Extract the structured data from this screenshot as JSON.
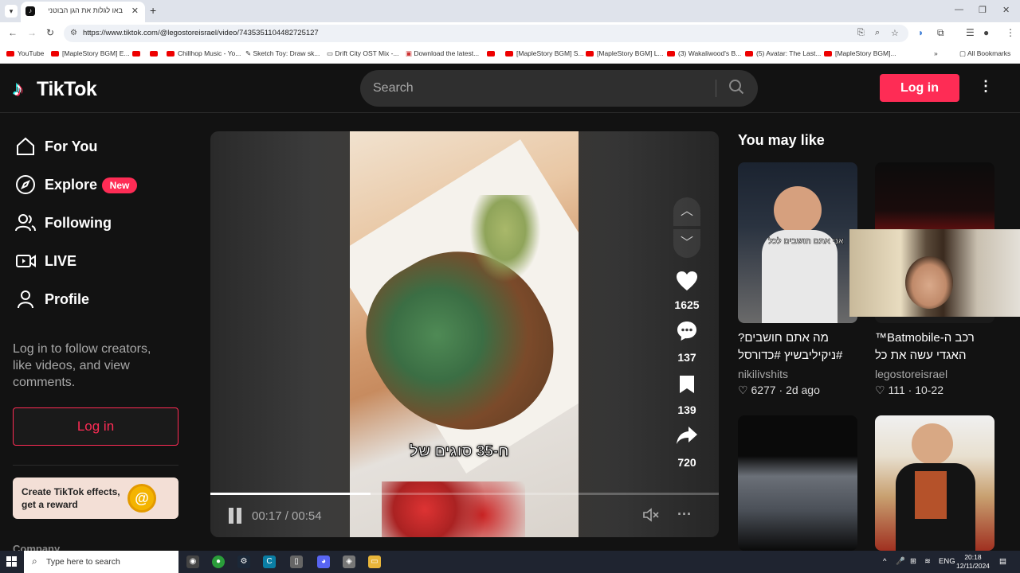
{
  "browser": {
    "tab_title": "באו לגלות את הגן הבוטני",
    "url": "https://www.tiktok.com/@legostoreisrael/video/7435351104482725127",
    "bookmarks": [
      "YouTube",
      "[MapleStory BGM] E...",
      "",
      "",
      "Chillhop Music - Yo...",
      "Sketch Toy: Draw sk...",
      "Drift City OST Mix -...",
      "Download the latest...",
      "",
      "[MapleStory BGM] S...",
      "[MapleStory BGM] L...",
      "(3) Wakaliwood's B...",
      "(5) Avatar: The Last...",
      "[MapleStory BGM]..."
    ],
    "all_bookmarks": "All Bookmarks"
  },
  "header": {
    "logo_text": "TikTok",
    "search_placeholder": "Search",
    "login_label": "Log in"
  },
  "sidebar": {
    "items": [
      {
        "label": "For You",
        "icon": "home-icon"
      },
      {
        "label": "Explore",
        "icon": "compass-icon"
      },
      {
        "label": "Following",
        "icon": "users-icon"
      },
      {
        "label": "LIVE",
        "icon": "live-icon"
      },
      {
        "label": "Profile",
        "icon": "profile-icon"
      }
    ],
    "new_badge": "New",
    "login_note": "Log in to follow creators, like videos, and view comments.",
    "login_button": "Log in",
    "effects_promo": "Create TikTok effects, get a reward",
    "company": "Company"
  },
  "video": {
    "caption": "ח-35 סוגים של",
    "likes": "1625",
    "comments": "137",
    "bookmarks": "139",
    "shares": "720",
    "time": "00:17 / 00:54",
    "progress": 0.315
  },
  "recommendations": {
    "title": "You may like",
    "items": [
      {
        "caption": "מה אתם חושבים? #ניקיליבשיץ #כדורסל",
        "author": "nikilivshits",
        "likes": "6277",
        "date": "2d ago"
      },
      {
        "caption": "רכב ה-Batmobile™ האגדי עשה את כל הדרך...",
        "author": "legostoreisrael",
        "likes": "111",
        "date": "10-22"
      }
    ],
    "thumb_overlay_1": "אני אתם חושבים לכל"
  },
  "taskbar": {
    "search_placeholder": "Type here to search",
    "lang": "ENG",
    "time": "20:18",
    "date": "12/11/2024"
  },
  "colors": {
    "brand": "#fe2c55",
    "background": "#121212"
  }
}
